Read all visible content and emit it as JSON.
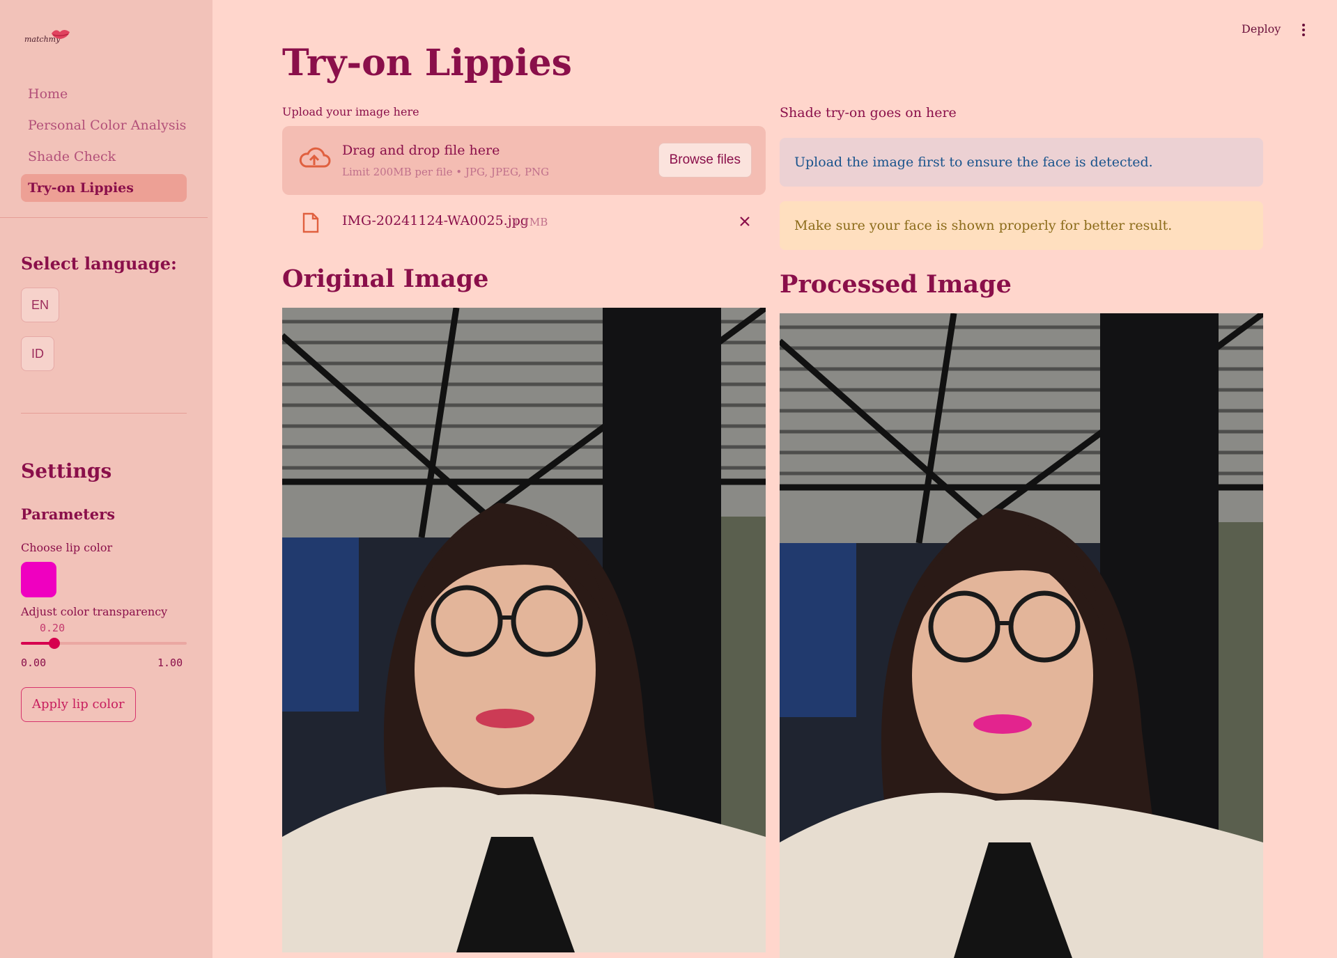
{
  "sidebar": {
    "logo_text": "matchmy",
    "nav": [
      {
        "label": "Home",
        "active": false
      },
      {
        "label": "Personal Color Analysis",
        "active": false
      },
      {
        "label": "Shade Check",
        "active": false
      },
      {
        "label": "Try-on Lippies",
        "active": true
      }
    ],
    "language_heading": "Select language:",
    "languages": [
      "EN",
      "ID"
    ],
    "settings_heading": "Settings",
    "parameters_heading": "Parameters",
    "lip_color_label": "Choose lip color",
    "lip_color": "#ef00c0",
    "transparency_label": "Adjust color transparency",
    "transparency_value": "0.20",
    "transparency_min": "0.00",
    "transparency_max": "1.00",
    "transparency_fraction": 0.2,
    "apply_button": "Apply lip color"
  },
  "header": {
    "deploy": "Deploy",
    "menu_icon": "kebab-menu-icon"
  },
  "main": {
    "title": "Try-on Lippies",
    "upload_label": "Upload your image here",
    "dropzone": {
      "title": "Drag and drop file here",
      "limit": "Limit 200MB per file • JPG, JPEG, PNG",
      "browse": "Browse files"
    },
    "file": {
      "name": "IMG-20241124-WA0025.jpg",
      "size": "1.1MB"
    },
    "shade_label": "Shade try-on goes on here",
    "info_alert": "Upload the image first to ensure the face is detected.",
    "warning_alert": "Make sure your face is shown properly for better result.",
    "original_title": "Original Image",
    "processed_title": "Processed Image"
  }
}
